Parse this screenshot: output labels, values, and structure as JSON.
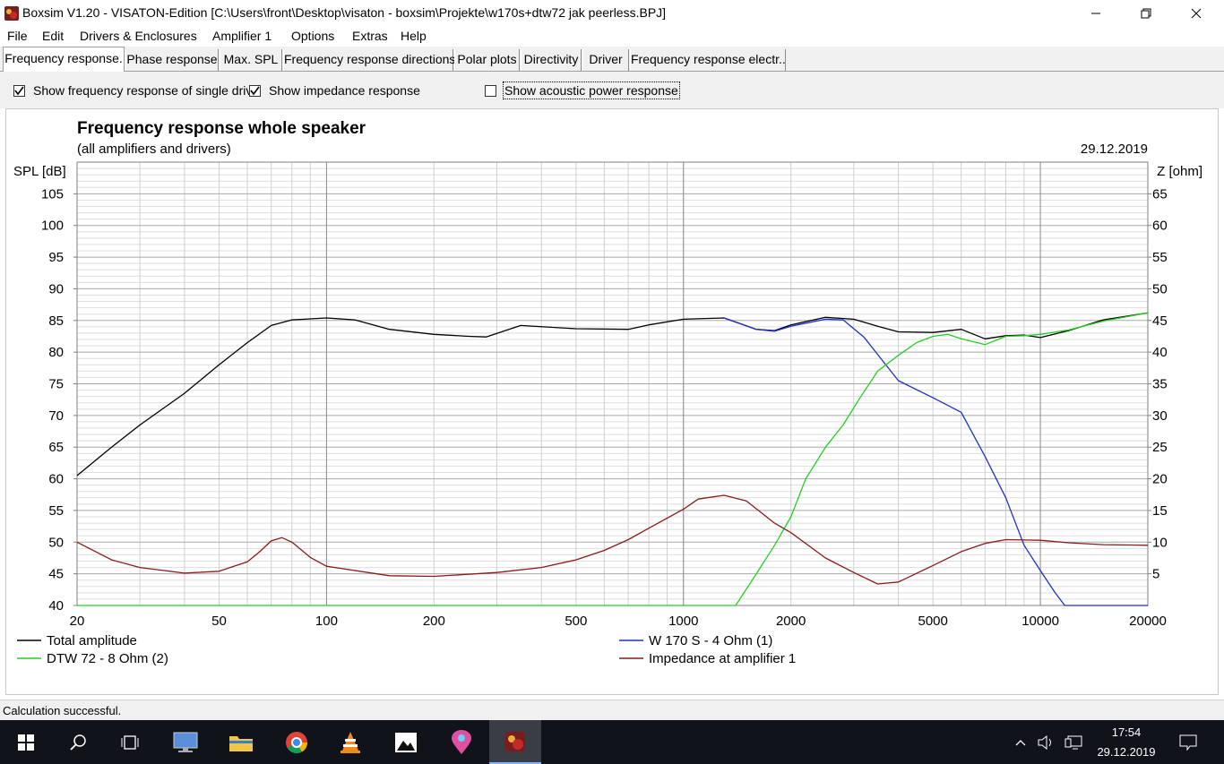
{
  "window": {
    "title": "Boxsim V1.20 - VISATON-Edition [C:\\Users\\front\\Desktop\\visaton - boxsim\\Projekte\\w170s+dtw72 jak peerless.BPJ]"
  },
  "menu": [
    "File",
    "Edit",
    "Drivers & Enclosures",
    "Amplifier 1",
    "Options",
    "Extras",
    "Help"
  ],
  "tabs": [
    {
      "label": "Frequency response.",
      "active": true
    },
    {
      "label": "Phase response"
    },
    {
      "label": "Max. SPL"
    },
    {
      "label": "Frequency response directions"
    },
    {
      "label": "Polar plots"
    },
    {
      "label": "Directivity"
    },
    {
      "label": "Driver"
    },
    {
      "label": "Frequency response electr.."
    }
  ],
  "options": {
    "single_drive": {
      "label": "Show frequency response of single drive",
      "checked": true
    },
    "impedance": {
      "label": "Show impedance response",
      "checked": true
    },
    "acoustic_power": {
      "label": "Show acoustic power response",
      "checked": false
    }
  },
  "status": "Calculation successful.",
  "taskbar": {
    "time": "17:54",
    "date": "29.12.2019"
  },
  "colors": {
    "total": "#000000",
    "woofer": "#1f2fd0",
    "tweeter": "#22d022",
    "impedance": "#8b1a1a"
  },
  "chart_data": {
    "type": "line",
    "title": "Frequency response whole speaker",
    "subtitle": "(all amplifiers and drivers)",
    "date": "29.12.2019",
    "ylabel": "SPL [dB]",
    "y2label": "Z [ohm]",
    "xscale": "log",
    "xlim": [
      20,
      20000
    ],
    "ylim": [
      40,
      110
    ],
    "y2lim": [
      0,
      70
    ],
    "xticks": [
      20,
      50,
      100,
      200,
      500,
      1000,
      2000,
      5000,
      10000,
      20000
    ],
    "yticks": [
      40,
      45,
      50,
      55,
      60,
      65,
      70,
      75,
      80,
      85,
      90,
      95,
      100,
      105
    ],
    "y2ticks": [
      5,
      10,
      15,
      20,
      25,
      30,
      35,
      40,
      45,
      50,
      55,
      60,
      65
    ],
    "grid": true,
    "legend": "bottom",
    "series": [
      {
        "name": "Total amplitude",
        "color_key": "total",
        "axis": "left",
        "points": [
          [
            20,
            60.5
          ],
          [
            25,
            65
          ],
          [
            30,
            68.5
          ],
          [
            40,
            73.5
          ],
          [
            50,
            78
          ],
          [
            60,
            81.5
          ],
          [
            70,
            84.2
          ],
          [
            80,
            85.1
          ],
          [
            100,
            85.4
          ],
          [
            120,
            85.1
          ],
          [
            150,
            83.6
          ],
          [
            200,
            82.8
          ],
          [
            250,
            82.5
          ],
          [
            280,
            82.4
          ],
          [
            350,
            84.2
          ],
          [
            500,
            83.7
          ],
          [
            700,
            83.6
          ],
          [
            800,
            84.3
          ],
          [
            1000,
            85.2
          ],
          [
            1300,
            85.4
          ],
          [
            1600,
            83.6
          ],
          [
            1800,
            83.4
          ],
          [
            2000,
            84.3
          ],
          [
            2500,
            85.5
          ],
          [
            3000,
            85.2
          ],
          [
            3500,
            84.1
          ],
          [
            4000,
            83.2
          ],
          [
            5000,
            83.1
          ],
          [
            6000,
            83.6
          ],
          [
            7000,
            82.1
          ],
          [
            8000,
            82.6
          ],
          [
            9000,
            82.7
          ],
          [
            10000,
            82.3
          ],
          [
            12000,
            83.4
          ],
          [
            15000,
            85.1
          ],
          [
            20000,
            86.2
          ]
        ]
      },
      {
        "name": "W 170 S - 4 Ohm (1)",
        "color_key": "woofer",
        "axis": "left",
        "points": [
          [
            1300,
            85.4
          ],
          [
            1600,
            83.6
          ],
          [
            1800,
            83.3
          ],
          [
            2000,
            84.1
          ],
          [
            2500,
            85.2
          ],
          [
            2800,
            85.1
          ],
          [
            3200,
            82.4
          ],
          [
            4000,
            75.5
          ],
          [
            5000,
            72.8
          ],
          [
            6000,
            70.5
          ],
          [
            7000,
            63.5
          ],
          [
            8000,
            57
          ],
          [
            9000,
            49.5
          ],
          [
            10000,
            45.5
          ],
          [
            11000,
            42
          ],
          [
            11700,
            40
          ],
          [
            20000,
            40
          ]
        ]
      },
      {
        "name": "DTW 72 - 8 Ohm (2)",
        "color_key": "tweeter",
        "axis": "left",
        "points": [
          [
            20,
            40
          ],
          [
            1400,
            40
          ],
          [
            1600,
            45
          ],
          [
            1800,
            49.5
          ],
          [
            2000,
            54
          ],
          [
            2200,
            60
          ],
          [
            2500,
            65
          ],
          [
            2800,
            68.5
          ],
          [
            3100,
            72.5
          ],
          [
            3500,
            77
          ],
          [
            4000,
            79.5
          ],
          [
            4500,
            81.5
          ],
          [
            5000,
            82.5
          ],
          [
            5500,
            82.8
          ],
          [
            6000,
            82.1
          ],
          [
            7000,
            81.2
          ],
          [
            8000,
            82.5
          ],
          [
            9000,
            82.6
          ],
          [
            10000,
            82.8
          ],
          [
            12000,
            83.5
          ],
          [
            15000,
            84.9
          ],
          [
            20000,
            86.2
          ]
        ]
      },
      {
        "name": "Impedance at amplifier 1",
        "color_key": "impedance",
        "axis": "right",
        "points": [
          [
            20,
            10
          ],
          [
            25,
            7.2
          ],
          [
            30,
            6
          ],
          [
            40,
            5.1
          ],
          [
            50,
            5.4
          ],
          [
            60,
            6.9
          ],
          [
            65,
            8.5
          ],
          [
            70,
            10.2
          ],
          [
            75,
            10.7
          ],
          [
            80,
            10
          ],
          [
            90,
            7.6
          ],
          [
            100,
            6.2
          ],
          [
            150,
            4.7
          ],
          [
            200,
            4.6
          ],
          [
            300,
            5.2
          ],
          [
            400,
            6
          ],
          [
            500,
            7.2
          ],
          [
            600,
            8.7
          ],
          [
            700,
            10.4
          ],
          [
            800,
            12.2
          ],
          [
            1000,
            15.2
          ],
          [
            1100,
            16.8
          ],
          [
            1300,
            17.4
          ],
          [
            1500,
            16.5
          ],
          [
            1800,
            13
          ],
          [
            2000,
            11.5
          ],
          [
            2500,
            7.5
          ],
          [
            3000,
            5.2
          ],
          [
            3500,
            3.4
          ],
          [
            4000,
            3.7
          ],
          [
            5000,
            6.3
          ],
          [
            6000,
            8.5
          ],
          [
            7000,
            9.8
          ],
          [
            8000,
            10.4
          ],
          [
            10000,
            10.3
          ],
          [
            12000,
            9.9
          ],
          [
            15000,
            9.6
          ],
          [
            20000,
            9.5
          ]
        ]
      }
    ]
  }
}
